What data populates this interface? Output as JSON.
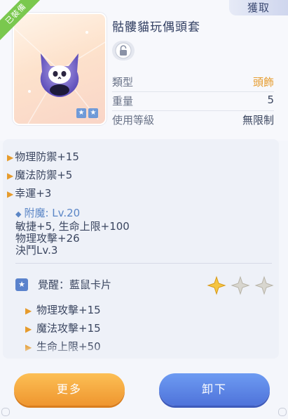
{
  "header": {
    "obtain_label": "獲取",
    "equipped_badge": "已裝備"
  },
  "item": {
    "name": "骷髏貓玩偶頭套",
    "image_icon": "skull-cat-mask-icon",
    "stars": [
      "★",
      "★"
    ],
    "lock_icon": "lock-icon",
    "info": [
      {
        "label": "類型",
        "value": "頭飾",
        "color": "#e69b2c"
      },
      {
        "label": "重量",
        "value": "5",
        "color": "#3b4660"
      },
      {
        "label": "使用等級",
        "value": "無限制",
        "color": "#3b4660"
      }
    ]
  },
  "stats": {
    "base": [
      "物理防禦+15",
      "魔法防禦+5",
      "幸運+3"
    ],
    "enchant_label": "附魔: Lv.20",
    "enchant_effects": [
      "敏捷+5, 生命上限+100",
      "物理攻擊+26",
      "決鬥Lv.3"
    ],
    "awaken_title": "覺醒：藍鼠卡片",
    "awaken_star_icons": [
      "star-filled-icon",
      "star-empty-icon",
      "star-empty-icon"
    ],
    "awaken_effects": [
      "物理攻擊+15",
      "魔法攻擊+15",
      "生命上限+50"
    ]
  },
  "buttons": {
    "more": "更多",
    "unequip": "卸下"
  },
  "colors": {
    "accent_orange": "#ef962f",
    "accent_blue": "#4f73da",
    "equipped_green": "#7ac84e"
  }
}
